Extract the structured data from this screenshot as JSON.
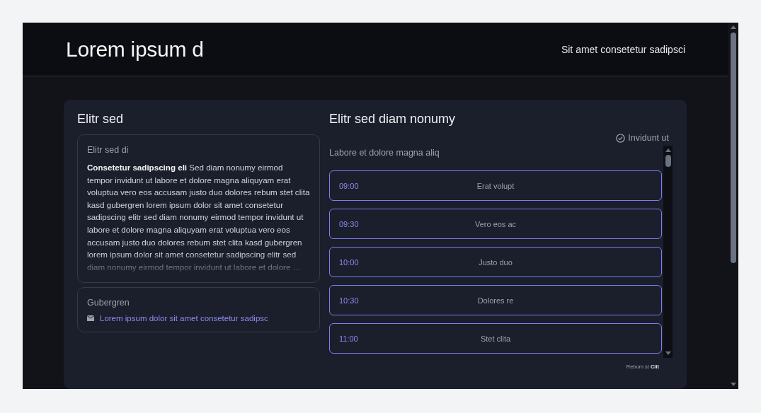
{
  "header": {
    "title": "Lorem ipsum d",
    "tagline": "Sit amet consetetur sadipsci"
  },
  "left": {
    "heading": "Elitr sed",
    "about": {
      "label": "Elitr sed di",
      "text": "**Consetetur sadipscing eli** Sed diam nonumy eirmod tempor invidunt ut labore et dolore magna aliquyam erat voluptua vero eos accusam justo duo dolores rebum stet clita kasd gubergren lorem ipsum dolor sit amet consetetur sadipscing elitr sed diam nonumy eirmod tempor invidunt ut labore et dolore magna aliquyam erat voluptua vero eos accusam justo duo dolores rebum stet clita kasd gubergren lorem ipsum dolor sit amet consetetur sadipscing elitr sed diam nonumy eirmod tempor invidunt ut labore et dolore …"
    },
    "contact": {
      "label": "Gubergren",
      "email": "Lorem ipsum dolor sit amet consetetur sadipsc"
    }
  },
  "right": {
    "heading": "Elitr sed diam nonumy",
    "status": "Invidunt ut",
    "subtitle": "Labore et dolore magna aliq",
    "slots": [
      {
        "time": "09:00",
        "title": "Erat volupt"
      },
      {
        "time": "09:30",
        "title": "Vero eos ac"
      },
      {
        "time": "10:00",
        "title": "Justo duo"
      },
      {
        "time": "10:30",
        "title": "Dolores re"
      },
      {
        "time": "11:00",
        "title": "Stet clita"
      }
    ],
    "footer": "Rebum st **Clit**"
  }
}
